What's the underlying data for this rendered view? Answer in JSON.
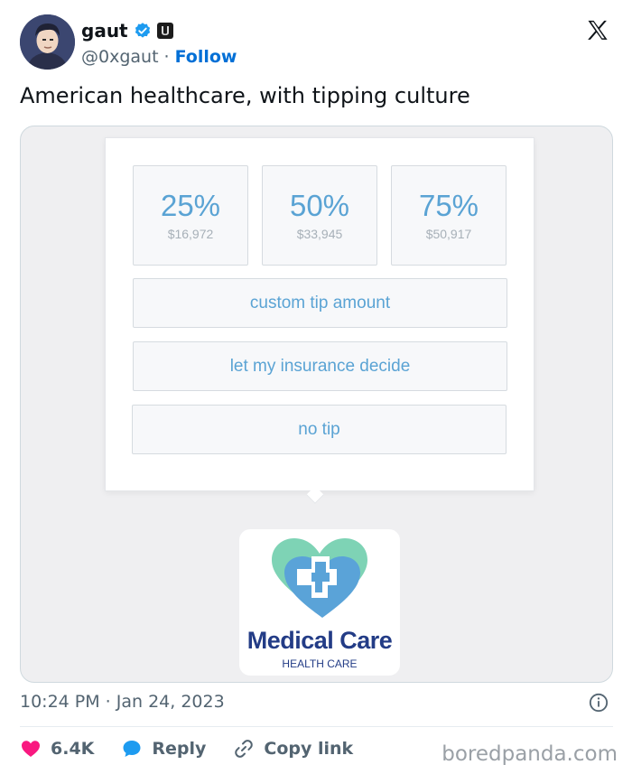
{
  "author": {
    "name": "gaut",
    "handle": "@0xgaut",
    "separator": "·",
    "follow_label": "Follow"
  },
  "tweet": {
    "text": "American healthcare, with tipping culture",
    "timestamp": "10:24 PM · Jan 24, 2023"
  },
  "tip_dialog": {
    "options": [
      {
        "percent": "25%",
        "amount": "$16,972"
      },
      {
        "percent": "50%",
        "amount": "$33,945"
      },
      {
        "percent": "75%",
        "amount": "$50,917"
      }
    ],
    "custom_label": "custom tip amount",
    "insurance_label": "let my insurance decide",
    "no_tip_label": "no tip"
  },
  "logo": {
    "title": "Medical Care",
    "subtitle": "HEALTH CARE"
  },
  "actions": {
    "likes": "6.4K",
    "reply_label": "Reply",
    "copy_label": "Copy link"
  },
  "watermark": "boredpanda.com",
  "colors": {
    "accent": "#006fd6",
    "like": "#f91880",
    "reply": "#1d9bf0",
    "tip_text": "#5aa3d4",
    "logo_blue": "#233c86"
  }
}
